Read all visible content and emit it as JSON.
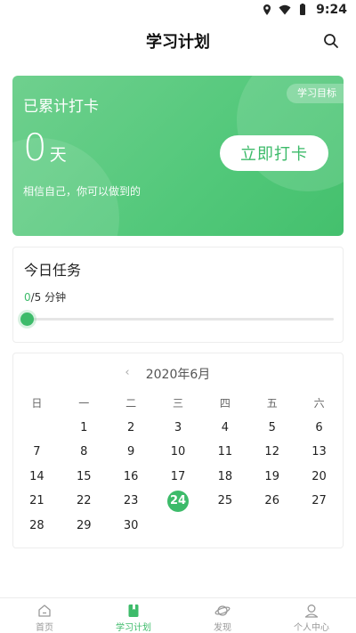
{
  "status_bar": {
    "time": "9:24"
  },
  "header": {
    "title": "学习计划"
  },
  "checkin": {
    "label": "已累计打卡",
    "goal_button": "学习目标",
    "days": "0",
    "unit": "天",
    "checkin_button": "立即打卡",
    "motto": "相信自己，你可以做到的"
  },
  "task": {
    "title": "今日任务",
    "done": "0",
    "rest": "/5 分钟",
    "progress": 0
  },
  "calendar": {
    "month": "2020年6月",
    "prev": "‹",
    "weekdays": [
      "日",
      "一",
      "二",
      "三",
      "四",
      "五",
      "六"
    ],
    "leading_blanks": 1,
    "days": [
      "1",
      "2",
      "3",
      "4",
      "5",
      "6",
      "7",
      "8",
      "9",
      "10",
      "11",
      "12",
      "13",
      "14",
      "15",
      "16",
      "17",
      "18",
      "19",
      "20",
      "21",
      "22",
      "23",
      "24",
      "25",
      "26",
      "27",
      "28",
      "29",
      "30"
    ],
    "today": "24"
  },
  "nav": {
    "items": [
      {
        "label": "首页",
        "icon": "home-icon"
      },
      {
        "label": "学习计划",
        "icon": "book-icon"
      },
      {
        "label": "发现",
        "icon": "planet-icon"
      },
      {
        "label": "个人中心",
        "icon": "person-icon"
      }
    ],
    "active_index": 1
  },
  "colors": {
    "accent": "#3dbb6a",
    "card_green": "#52c87a"
  }
}
